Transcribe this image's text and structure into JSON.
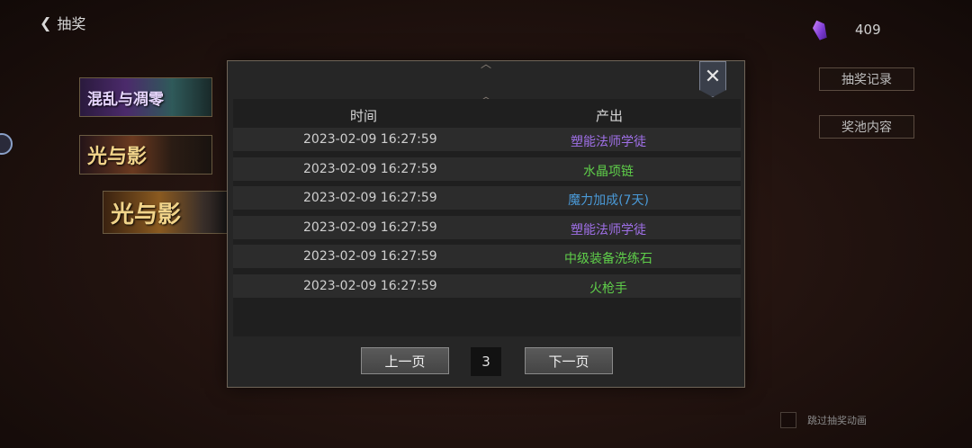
{
  "header": {
    "back_label": "抽奖"
  },
  "currency": {
    "amount": "409",
    "icon": "gem-icon"
  },
  "side": {
    "record_label": "抽奖记录",
    "pool_label": "奖池内容"
  },
  "skip": {
    "label": "跳过抽奖动画"
  },
  "banners": [
    {
      "text": "混乱与凋零"
    },
    {
      "text": "光与影"
    },
    {
      "text": "光与影"
    }
  ],
  "modal": {
    "close_icon": "close-icon",
    "columns": {
      "time": "时间",
      "output": "产出"
    },
    "rows": [
      {
        "time": "2023-02-09 16:27:59",
        "item": "塑能法师学徒",
        "color": "#a070e8"
      },
      {
        "time": "2023-02-09 16:27:59",
        "item": "水晶项链",
        "color": "#5fcf4a"
      },
      {
        "time": "2023-02-09 16:27:59",
        "item": "魔力加成(7天)",
        "color": "#4a9ad8"
      },
      {
        "time": "2023-02-09 16:27:59",
        "item": "塑能法师学徒",
        "color": "#a070e8"
      },
      {
        "time": "2023-02-09 16:27:59",
        "item": "中级装备洗练石",
        "color": "#5fcf4a"
      },
      {
        "time": "2023-02-09 16:27:59",
        "item": "火枪手",
        "color": "#5fcf4a"
      }
    ],
    "pager": {
      "prev_label": "上一页",
      "page": "3",
      "next_label": "下一页"
    }
  }
}
